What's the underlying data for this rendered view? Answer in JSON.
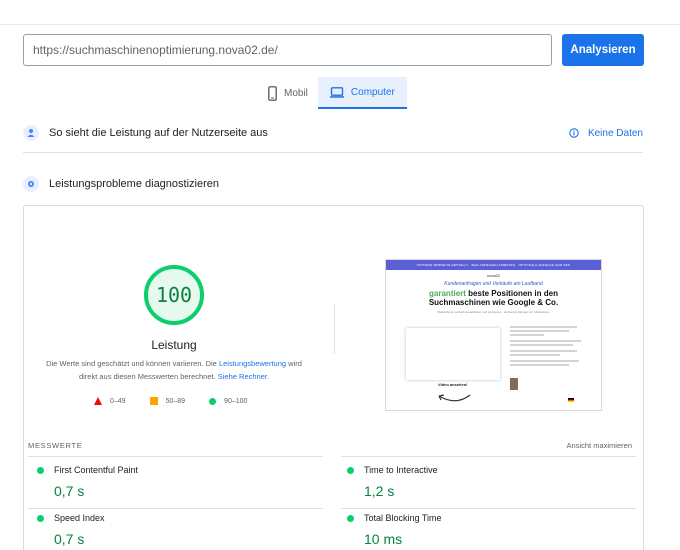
{
  "search": {
    "url_value": "https://suchmaschinenoptimierung.nova02.de/",
    "analyze_label": "Analysieren"
  },
  "tabs": [
    {
      "label": "Mobil",
      "icon": "smartphone-icon",
      "active": false
    },
    {
      "label": "Computer",
      "icon": "laptop-icon",
      "active": true
    }
  ],
  "field_data": {
    "title": "So sieht die Leistung auf der Nutzerseite aus",
    "no_data_label": "Keine Daten",
    "icon": "user-experience-icon"
  },
  "diagnostics": {
    "title": "Leistungsprobleme diagnostizieren",
    "icon": "lab-icon"
  },
  "score": {
    "value": "100",
    "fraction": 1.0,
    "label": "Leistung",
    "desc_part1": "Die Werte sind geschätzt und können variieren. Die ",
    "desc_link1": "Leistungsbewertung",
    "desc_part2": " wird direkt aus diesen Messwerten berechnet. ",
    "desc_link2": "Siehe Rechner.",
    "color": "#0cce6b"
  },
  "legend": [
    {
      "range": "0–49",
      "shape": "triangle",
      "color": "#eb0f00"
    },
    {
      "range": "50–89",
      "shape": "square",
      "color": "#ffa400"
    },
    {
      "range": "90–100",
      "shape": "circle",
      "color": "#0cce6b"
    }
  ],
  "preview": {
    "banner": "OPTIMIZE WEBSEITE ERSTELLT · SEO-ANFRAGEN ANBIETEN · OPTIONALE ANFRAGE ZUM SEO",
    "logo": "nova02",
    "subtitle": "Kundenanfragen und Verkäufe am Laufband",
    "headline_green": "garantiert",
    "headline_rest1": " beste Positionen in den",
    "headline_line2": "Suchmaschinen wie Google & Co.",
    "small_text": "Maßnahmen einfach ausarbeiten und profitieren - ab bereits Morgen zur Absolvieren",
    "video_label": "Video ansehen!"
  },
  "metrics_header": {
    "title": "MESSWERTE",
    "expand_label": "Ansicht maximieren"
  },
  "metrics": [
    {
      "name": "First Contentful Paint",
      "value": "0,7 s"
    },
    {
      "name": "Time to Interactive",
      "value": "1,2 s"
    },
    {
      "name": "Speed Index",
      "value": "0,7 s"
    },
    {
      "name": "Total Blocking Time",
      "value": "10 ms"
    }
  ]
}
